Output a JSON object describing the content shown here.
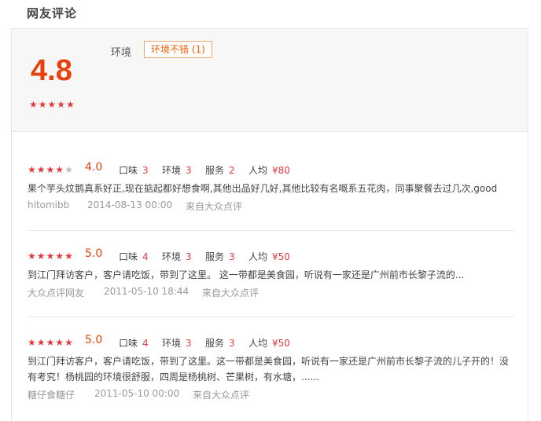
{
  "section_title": "网友评论",
  "summary": {
    "score": "4.8",
    "stars": 5,
    "env_label": "环境",
    "tag": "环境不错 (1)"
  },
  "labels": {
    "taste": "口味",
    "environment": "环境",
    "service": "服务",
    "avg_price": "人均"
  },
  "reviews": [
    {
      "stars": 4,
      "score": "4.0",
      "taste": "3",
      "environment": "3",
      "service": "2",
      "price": "¥80",
      "text": "果个芋头炆鹅真系好正,现在掂起都好想食啊,其他出品好几好,其他比较有名嘅系五花肉，同事聚餐去过几次,good",
      "user": "hitomibb",
      "date": "2014-08-13 00:00",
      "source": "来自大众点评"
    },
    {
      "stars": 5,
      "score": "5.0",
      "taste": "4",
      "environment": "3",
      "service": "3",
      "price": "¥50",
      "text": "到江门拜访客户，客户请吃饭，带到了这里。 这一带都是美食园，听说有一家还是广州前市长黎子流的...",
      "user": "大众点评网友",
      "date": "2011-05-10 18:44",
      "source": "来自大众点评"
    },
    {
      "stars": 5,
      "score": "5.0",
      "taste": "4",
      "environment": "3",
      "service": "3",
      "price": "¥50",
      "text": "到江门拜访客户，客户请吃饭，带到了这里。这一带都是美食园，听说有一家还是广州前市长黎子流的儿子开的！没有考究！杨桃园的环境很舒服，四周是杨桃树、芒果树，有水塘，......",
      "user": "糖仔食糖仔",
      "date": "2011-05-10 00:00",
      "source": "来自大众点评"
    }
  ],
  "colors": {
    "accent": "#e8410c",
    "star": "#e4393c",
    "star_empty": "#bbbbbb",
    "tag_border": "#f5a66b"
  }
}
